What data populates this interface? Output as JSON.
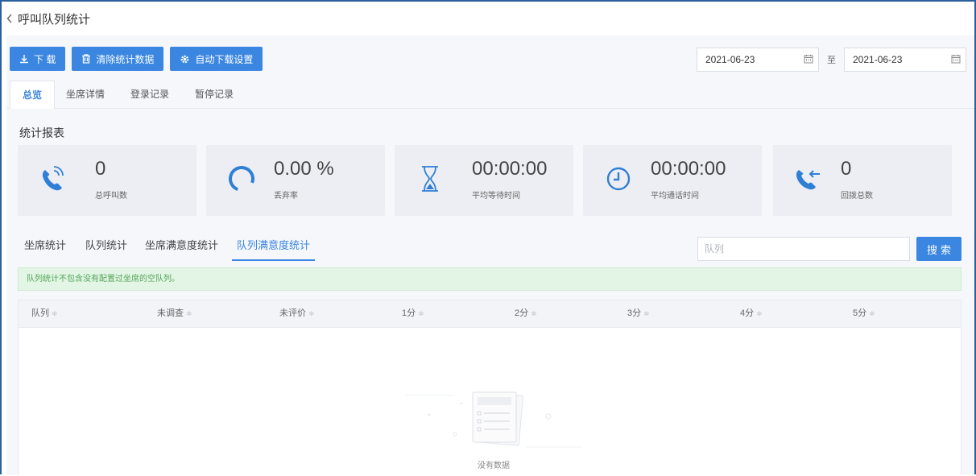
{
  "page": {
    "title": "呼叫队列统计"
  },
  "toolbar": {
    "download_label": "下 载",
    "clear_label": "清除统计数据",
    "auto_download_label": "自动下载设置"
  },
  "date_range": {
    "start": "2021-06-23",
    "separator": "至",
    "end": "2021-06-23"
  },
  "top_tabs": [
    "总览",
    "坐席详情",
    "登录记录",
    "暂停记录"
  ],
  "section_title": "统计报表",
  "stats": [
    {
      "value": "0",
      "label": "总呼叫数",
      "icon": "phone-ringing-icon"
    },
    {
      "value": "0.00 %",
      "label": "丢弃率",
      "icon": "progress-ring-icon"
    },
    {
      "value": "00:00:00",
      "label": "平均等待时间",
      "icon": "hourglass-icon"
    },
    {
      "value": "00:00:00",
      "label": "平均通话时间",
      "icon": "clock-icon"
    },
    {
      "value": "0",
      "label": "回拨总数",
      "icon": "phone-callback-icon"
    }
  ],
  "bottom_tabs": [
    "坐席统计",
    "队列统计",
    "坐席满意度统计",
    "队列满意度统计"
  ],
  "search": {
    "placeholder": "队列",
    "button_label": "搜索"
  },
  "notice": "队列统计不包含没有配置过坐席的空队列。",
  "table": {
    "columns": [
      "队列",
      "未调查",
      "未评价",
      "1分",
      "2分",
      "3分",
      "4分",
      "5分"
    ],
    "empty_text": "没有数据"
  },
  "colors": {
    "accent": "#3a86e0",
    "notice_bg": "#e3f5e4",
    "notice_text": "#52a55a"
  }
}
